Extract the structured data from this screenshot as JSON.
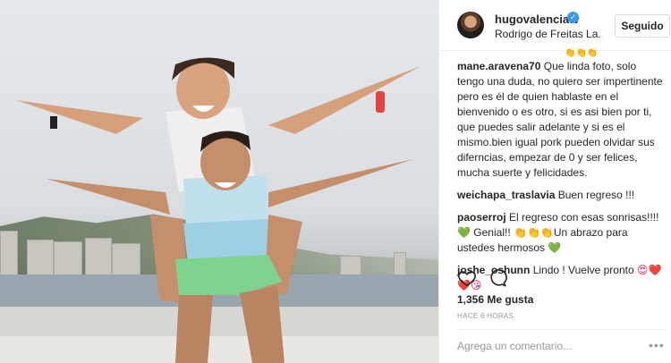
{
  "header": {
    "username": "hugovalenciatv",
    "location": "Rodrigo de Freitas La...",
    "follow_label": "Seguido"
  },
  "comments": [
    {
      "user": "mane.aravena70",
      "text": "Que linda foto, solo tengo una duda, no quiero ser impertinente pero es él de quien hablaste en el bienvenido o es otro, si es asi bien por ti, que puedes salir adelante y si es el mismo.bien igual pork pueden olvidar sus diferncias, empezar de 0 y ser felices, mucha suerte y felicidades."
    },
    {
      "user": "weichapa_traslavia",
      "text": "Buen regreso !!!"
    },
    {
      "user": "paoserroj",
      "text_a": "El regreso con esas sonrisas!!!!",
      "text_b": "Genial!!",
      "text_c": "Un abrazo para ustedes hermosos"
    },
    {
      "user": "joshe_oshunn",
      "text": "Lindo ! Vuelve pronto"
    }
  ],
  "likes_text": "1,356 Me gusta",
  "time_text": "HACE 6 HORAS",
  "add_comment_placeholder": "Agrega un comentario...",
  "more_label": "•••",
  "colors": {
    "verified": "#3897f0",
    "heart": "#e0245e",
    "green": "#2eaa3a"
  },
  "icons": [
    "verified-icon",
    "heart-icon",
    "comment-icon",
    "more-options-icon"
  ]
}
